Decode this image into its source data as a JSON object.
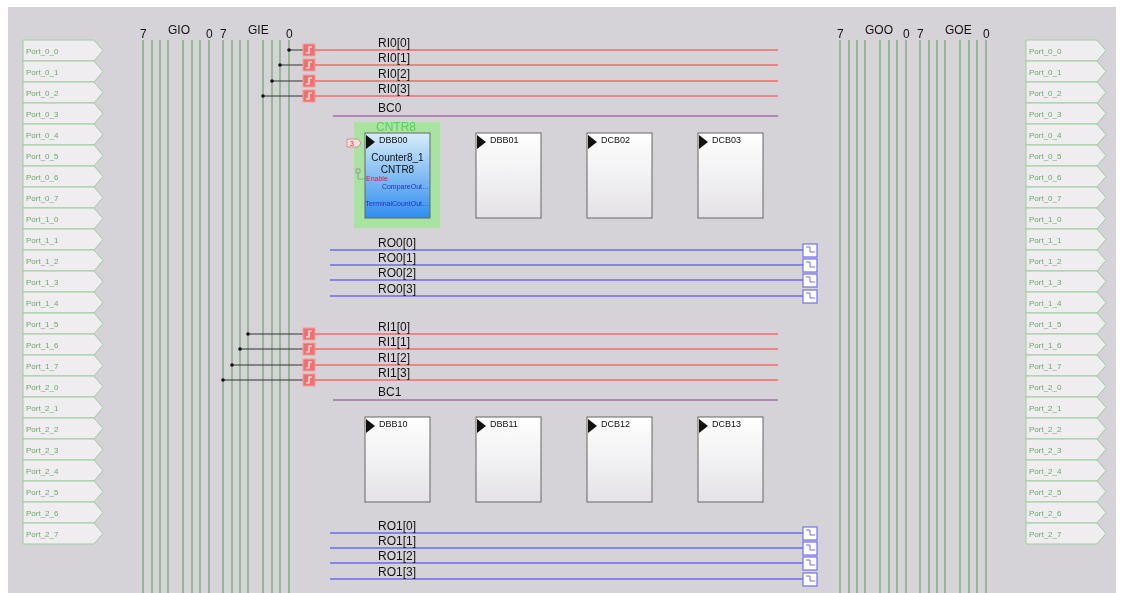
{
  "left_ports": [
    "Port_0_0",
    "Port_0_1",
    "Port_0_2",
    "Port_0_3",
    "Port_0_4",
    "Port_0_5",
    "Port_0_6",
    "Port_0_7",
    "Port_1_0",
    "Port_1_1",
    "Port_1_2",
    "Port_1_3",
    "Port_1_4",
    "Port_1_5",
    "Port_1_6",
    "Port_1_7",
    "Port_2_0",
    "Port_2_1",
    "Port_2_2",
    "Port_2_3",
    "Port_2_4",
    "Port_2_5",
    "Port_2_6",
    "Port_2_7"
  ],
  "right_ports": [
    "Port_0_0",
    "Port_0_1",
    "Port_0_2",
    "Port_0_3",
    "Port_0_4",
    "Port_0_5",
    "Port_0_6",
    "Port_0_7",
    "Port_1_0",
    "Port_1_1",
    "Port_1_2",
    "Port_1_3",
    "Port_1_4",
    "Port_1_5",
    "Port_1_6",
    "Port_1_7",
    "Port_2_0",
    "Port_2_1",
    "Port_2_2",
    "Port_2_3",
    "Port_2_4",
    "Port_2_5",
    "Port_2_6",
    "Port_2_7"
  ],
  "left_buses": [
    {
      "name": "GIO",
      "msb": "7",
      "lsb": "0"
    },
    {
      "name": "GIE",
      "msb": "7",
      "lsb": "0"
    }
  ],
  "right_buses": [
    {
      "name": "GOO",
      "msb": "7",
      "lsb": "0"
    },
    {
      "name": "GOE",
      "msb": "7",
      "lsb": "0"
    }
  ],
  "rows": [
    {
      "inputs": [
        "RI0[0]",
        "RI0[1]",
        "RI0[2]",
        "RI0[3]"
      ],
      "clock": "BC0",
      "blocks": [
        {
          "name": "DBB00",
          "module": {
            "tag": "CNTR8",
            "instance": "Counter8_1",
            "type": "CNTR8",
            "clock_pin": "3",
            "enable_pin": "Enable",
            "outputs": [
              "CompareOut…",
              "TerminalCountOut…"
            ]
          }
        },
        {
          "name": "DBB01"
        },
        {
          "name": "DCB02"
        },
        {
          "name": "DCB03"
        }
      ],
      "outputs": [
        "RO0[0]",
        "RO0[1]",
        "RO0[2]",
        "RO0[3]"
      ]
    },
    {
      "inputs": [
        "RI1[0]",
        "RI1[1]",
        "RI1[2]",
        "RI1[3]"
      ],
      "clock": "BC1",
      "blocks": [
        {
          "name": "DBB10"
        },
        {
          "name": "DBB11"
        },
        {
          "name": "DCB12"
        },
        {
          "name": "DCB13"
        }
      ],
      "outputs": [
        "RO1[0]",
        "RO1[1]",
        "RO1[2]",
        "RO1[3]"
      ]
    }
  ]
}
